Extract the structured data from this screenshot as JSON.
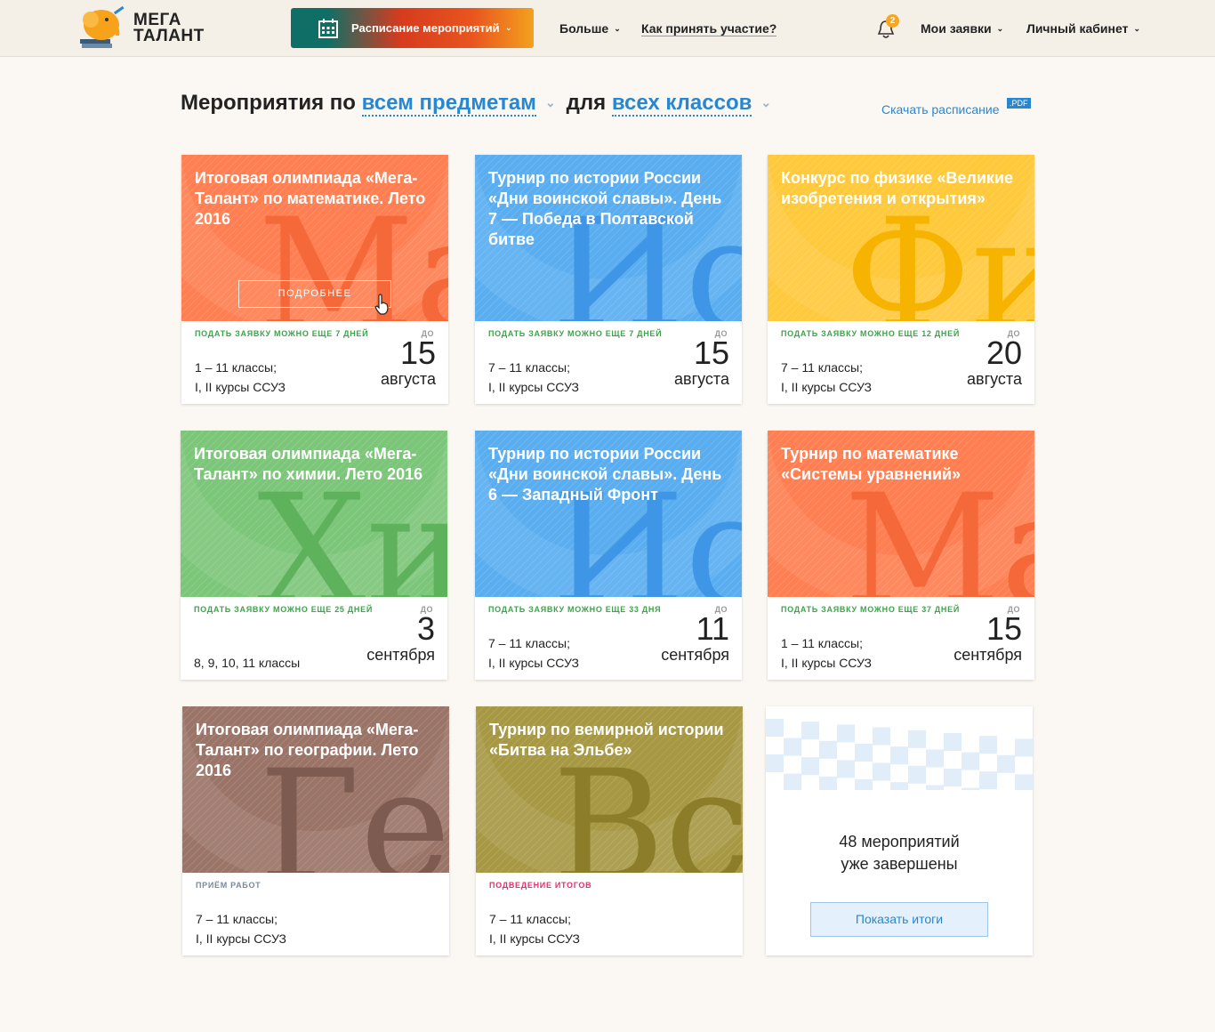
{
  "header": {
    "logo": {
      "line1": "МЕГА",
      "line2": "ТАЛАНТ"
    },
    "schedule_label": "Расписание мероприятий",
    "more_label": "Больше",
    "how_to_label": "Как принять участие?",
    "notifications_count": "2",
    "my_applications_label": "Мои заявки",
    "account_label": "Личный кабинет"
  },
  "filters": {
    "prefix": "Мероприятия по",
    "subject": "всем предметам",
    "middle": "для",
    "grade": "всех классов",
    "download_label": "Скачать расписание",
    "pdf_label": ".PDF"
  },
  "cards": [
    {
      "title": "Итоговая олимпиада «Мега-Талант» по математике. Лето 2016",
      "letters": "Ма",
      "color": "#ff7f52",
      "letters_color": "#f4683a",
      "deadline": "ПОДАТЬ ЗАЯВКУ МОЖНО ЕЩЕ 7 ДНЕЙ",
      "deadline_color": "#3ea34a",
      "do": "ДО",
      "grades_line1": "1 – 11 классы;",
      "grades_line2": "I, II курсы ССУЗ",
      "day": "15",
      "month": "августа",
      "details": "ПОДРОБНЕЕ"
    },
    {
      "title": "Турнир по истории России «Дни воинской славы». День 7 — Победа в Полтавской битве",
      "letters": "Ис",
      "color": "#5aaef0",
      "letters_color": "#3f96e6",
      "deadline": "ПОДАТЬ ЗАЯВКУ МОЖНО ЕЩЕ 7 ДНЕЙ",
      "deadline_color": "#3ea34a",
      "do": "ДО",
      "grades_line1": "7 – 11 классы;",
      "grades_line2": "I, II курсы ССУЗ",
      "day": "15",
      "month": "августа"
    },
    {
      "title": "Конкурс по физике «Великие изобретения и открытия»",
      "letters": "Фи",
      "color": "#ffc93c",
      "letters_color": "#f6b400",
      "deadline": "ПОДАТЬ ЗАЯВКУ МОЖНО ЕЩЕ 12 ДНЕЙ",
      "deadline_color": "#3ea34a",
      "do": "ДО",
      "grades_line1": "7 – 11 классы;",
      "grades_line2": "I, II курсы ССУЗ",
      "day": "20",
      "month": "августа"
    },
    {
      "title": "Итоговая олимпиада «Мега-Талант» по химии. Лето 2016",
      "letters": "Хи",
      "color": "#7cc67a",
      "letters_color": "#5fb25c",
      "deadline": "ПОДАТЬ ЗАЯВКУ МОЖНО ЕЩЕ 25 ДНЕЙ",
      "deadline_color": "#3ea34a",
      "do": "ДО",
      "grades_line1": "",
      "grades_line2": "8, 9, 10, 11 классы",
      "day": "3",
      "month": "сентября"
    },
    {
      "title": "Турнир по истории России «Дни воинской славы». День 6 — Западный Фронт",
      "letters": "Ис",
      "color": "#5aaef0",
      "letters_color": "#3f96e6",
      "deadline": "ПОДАТЬ ЗАЯВКУ МОЖНО ЕЩЕ 33 ДНЯ",
      "deadline_color": "#3ea34a",
      "do": "ДО",
      "grades_line1": "7 – 11 классы;",
      "grades_line2": "I, II курсы ССУЗ",
      "day": "11",
      "month": "сентября"
    },
    {
      "title": "Турнир по математике «Системы уравнений»",
      "letters": "Ма",
      "color": "#ff7f52",
      "letters_color": "#f4683a",
      "deadline": "ПОДАТЬ ЗАЯВКУ МОЖНО ЕЩЕ 37 ДНЕЙ",
      "deadline_color": "#3ea34a",
      "do": "ДО",
      "grades_line1": "1 – 11 классы;",
      "grades_line2": "I, II курсы ССУЗ",
      "day": "15",
      "month": "сентября"
    },
    {
      "title": "Итоговая олимпиада «Мега-Талант» по географии. Лето 2016",
      "letters": "Гео",
      "color": "#9b7468",
      "letters_color": "#7e5b50",
      "deadline": "ПРИЁМ РАБОТ",
      "deadline_color": "#7a8a99",
      "do": "",
      "grades_line1": "7 – 11 классы;",
      "grades_line2": "I, II курсы ССУЗ",
      "day": "",
      "month": ""
    },
    {
      "title": "Турнир по вемирной истории «Битва на Эльбе»",
      "letters": "Все",
      "color": "#a79844",
      "letters_color": "#8c7d2a",
      "deadline": "ПОДВЕДЕНИЕ ИТОГОВ",
      "deadline_color": "#e0336b",
      "do": "",
      "grades_line1": "7 – 11 классы;",
      "grades_line2": "I, II курсы ССУЗ",
      "day": "",
      "month": ""
    }
  ],
  "summary": {
    "line1": "48 мероприятий",
    "line2": "уже завершены",
    "button_label": "Показать итоги"
  }
}
